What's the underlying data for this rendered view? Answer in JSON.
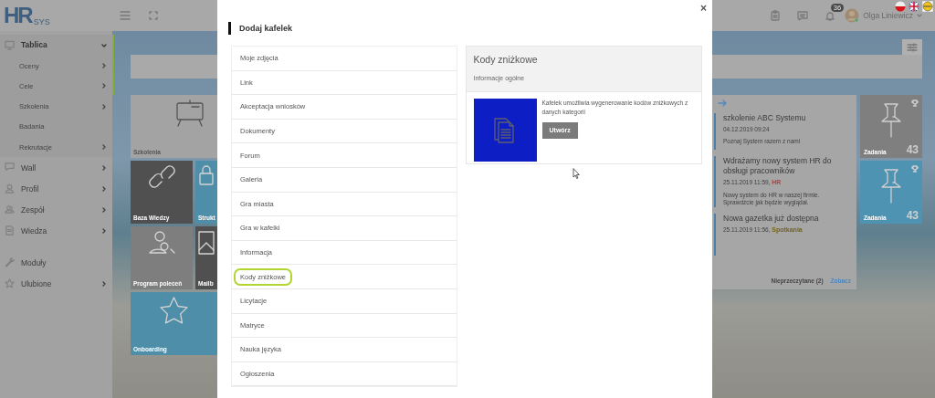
{
  "topbar": {
    "logo": {
      "main": "HR",
      "sub": "SYS"
    },
    "notifications_badge": "36",
    "user_name": "Olga Liniewicz"
  },
  "sidebar": {
    "items": [
      {
        "label": "Tablica",
        "selected": true,
        "expanded": true,
        "children": [
          {
            "label": "Oceny",
            "expanded": false
          },
          {
            "label": "Cele",
            "expanded": false
          },
          {
            "label": "Szkolenia",
            "expanded": false
          },
          {
            "label": "Badania"
          },
          {
            "label": "Rekrutacje",
            "expanded": false
          }
        ]
      },
      {
        "label": "Wall",
        "selected": false,
        "expanded": false
      },
      {
        "label": "Profil",
        "selected": false,
        "expanded": false
      },
      {
        "label": "Zespół",
        "selected": false,
        "expanded": false
      },
      {
        "label": "Wiedza",
        "selected": false,
        "expanded": false
      },
      {
        "label": "Moduły",
        "selected": false
      },
      {
        "label": "Ulubione",
        "selected": false,
        "expanded": false
      }
    ]
  },
  "tiles": [
    {
      "label": "Szkolenia",
      "color": "#a3a3a3",
      "wide": true
    },
    {
      "label": "Baza Wiedzy",
      "color": "#505050",
      "wide": false
    },
    {
      "label": "Strukt",
      "color": "#4e8ea9",
      "wide": false
    },
    {
      "label": "Program poleceń",
      "color": "#7e7e7e",
      "wide": false
    },
    {
      "label": "Mailb",
      "color": "#505050",
      "wide": false
    },
    {
      "label": "Onboarding",
      "color": "#4e8ea9",
      "wide": true
    }
  ],
  "news": {
    "items": [
      {
        "title": "szkolenie ABC Systemu",
        "date": "04.12.2019 09:24",
        "text": "Poznaj System razem z nami"
      },
      {
        "title": "Wdrażamy nowy system HR do obsługi pracowników",
        "date": "25.11.2019 11:59,",
        "tag": {
          "label": "HR",
          "color": "#a94442"
        },
        "text": "Nowy system do HR w naszej firmie. Sprawdźcie jak będzie wyglądał."
      },
      {
        "title": "Nowa gazetka już dostępna",
        "date": "25.11.2019 11:56,",
        "tag": {
          "label": "Spotkania",
          "color": "#7a6410"
        }
      }
    ],
    "unread": "Nieprzeczytane (2)",
    "link": "Zobacz"
  },
  "side_tiles": [
    {
      "label": "Zadania",
      "count": "43",
      "color": "#7f7f7f"
    },
    {
      "label": "Zadania",
      "count": "43",
      "color": "#4f93b2"
    }
  ],
  "modal": {
    "close": "×",
    "title": "Dodaj kafelek",
    "tile_types": [
      {
        "label": "Moje zdjęcia",
        "selected": false
      },
      {
        "label": "Link",
        "selected": false
      },
      {
        "label": "Akceptacja wniosków",
        "selected": false
      },
      {
        "label": "Dokumenty",
        "selected": false
      },
      {
        "label": "Forum",
        "selected": false
      },
      {
        "label": "Galeria",
        "selected": false
      },
      {
        "label": "Gra miasta",
        "selected": false
      },
      {
        "label": "Gra w kafelki",
        "selected": false
      },
      {
        "label": "Informacja",
        "selected": false
      },
      {
        "label": "Kody zniżkowe",
        "selected": true
      },
      {
        "label": "Licytacje",
        "selected": false
      },
      {
        "label": "Matryce",
        "selected": false
      },
      {
        "label": "Nauka języka",
        "selected": false
      },
      {
        "label": "Ogłoszenia",
        "selected": false
      }
    ],
    "detail": {
      "title": "Kody zniżkowe",
      "subtitle": "Informacje ogólne",
      "description": "Kafelek umożliwia wygenerowanie kodów zniżkowych z danych kategorii",
      "button": "Utwórz"
    }
  }
}
